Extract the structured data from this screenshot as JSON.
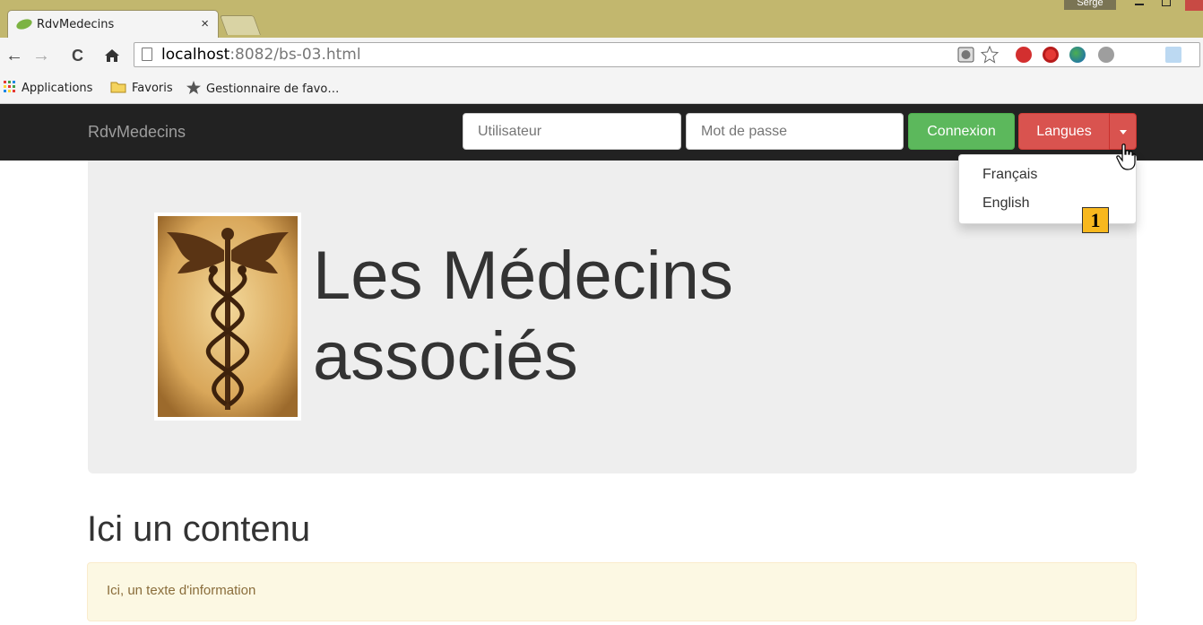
{
  "browser": {
    "tab_title": "RdvMedecins",
    "tab_close": "×",
    "user_badge": "Serge",
    "url_host": "localhost",
    "url_rest": ":8082/bs-03.html",
    "nav": {
      "back": "←",
      "forward": "→",
      "reload": "C",
      "home": "🏠"
    },
    "bookmarks": [
      {
        "label": "Applications",
        "icon": "apps-grid-icon"
      },
      {
        "label": "Favoris",
        "icon": "folder-icon"
      },
      {
        "label": "Gestionnaire de favo…",
        "icon": "star-icon"
      }
    ],
    "extensions": [
      "shield-icon",
      "star-outline-icon",
      "block-red-icon",
      "stop-red-icon",
      "globe-icon",
      "adblock-icon",
      "jetbrains-icon"
    ]
  },
  "navbar": {
    "brand": "RdvMedecins",
    "user_placeholder": "Utilisateur",
    "password_placeholder": "Mot de passe",
    "login_label": "Connexion",
    "languages_label": "Langues"
  },
  "dropdown": {
    "items": [
      "Français",
      "English"
    ]
  },
  "marker_label": "1",
  "jumbotron": {
    "title_line1": "Les Médecins",
    "title_line2": "associés",
    "logo_icon": "caduceus-icon"
  },
  "content": {
    "title": "Ici un contenu",
    "alert_text": "Ici, un texte d'information"
  },
  "colors": {
    "navbar_bg": "#222222",
    "success": "#5cb85c",
    "danger": "#d9534f",
    "jumbotron_bg": "#eeeeee",
    "alert_bg": "#fcf8e3"
  }
}
